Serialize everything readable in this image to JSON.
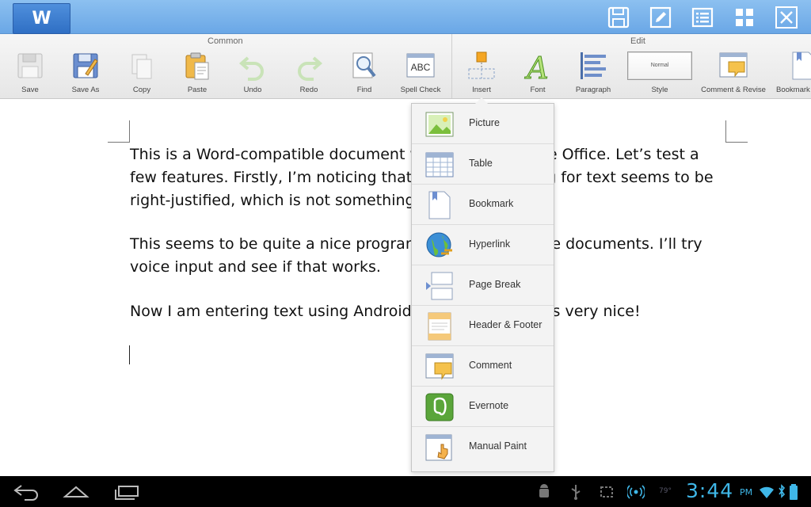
{
  "app": {
    "logo_letter": "W"
  },
  "ribbon": {
    "groups": {
      "common": "Common",
      "edit": "Edit"
    },
    "buttons": {
      "save": "Save",
      "save_as": "Save As",
      "copy": "Copy",
      "paste": "Paste",
      "undo": "Undo",
      "redo": "Redo",
      "find": "Find",
      "spell_check": "Spell Check",
      "insert": "Insert",
      "font": "Font",
      "paragraph": "Paragraph",
      "style": "Style",
      "comment_revise": "Comment & Revise",
      "bookmark": "Bookmark"
    },
    "style_preview": "Normal",
    "spell_icon_text": "ABC"
  },
  "document": {
    "paragraphs": [
      "This is a Word-compatible document written in Thinkfree Office. Let’s test a few features. Firstly, I’m noticing that the default setting for text seems to be right-justified, which is not something I like.",
      "This seems to be quite a nice program for creating Office documents. I’ll try voice input and see if that works.",
      "Now I am entering text using Android voice input and it’s very nice!"
    ]
  },
  "insert_menu": {
    "items": [
      {
        "label": "Picture",
        "icon": "picture-icon"
      },
      {
        "label": "Table",
        "icon": "table-icon"
      },
      {
        "label": "Bookmark",
        "icon": "bookmark-icon"
      },
      {
        "label": "Hyperlink",
        "icon": "hyperlink-icon"
      },
      {
        "label": "Page Break",
        "icon": "page-break-icon"
      },
      {
        "label": "Header & Footer",
        "icon": "header-footer-icon"
      },
      {
        "label": "Comment",
        "icon": "comment-icon"
      },
      {
        "label": "Evernote",
        "icon": "evernote-icon"
      },
      {
        "label": "Manual Paint",
        "icon": "manual-paint-icon"
      }
    ]
  },
  "statusbar": {
    "temperature": "79°",
    "time": "3:44",
    "ampm": "PM"
  },
  "colors": {
    "titlebar": "#7ab3ea",
    "clock": "#3fb7e8",
    "ribbon": "#eeeeee"
  }
}
